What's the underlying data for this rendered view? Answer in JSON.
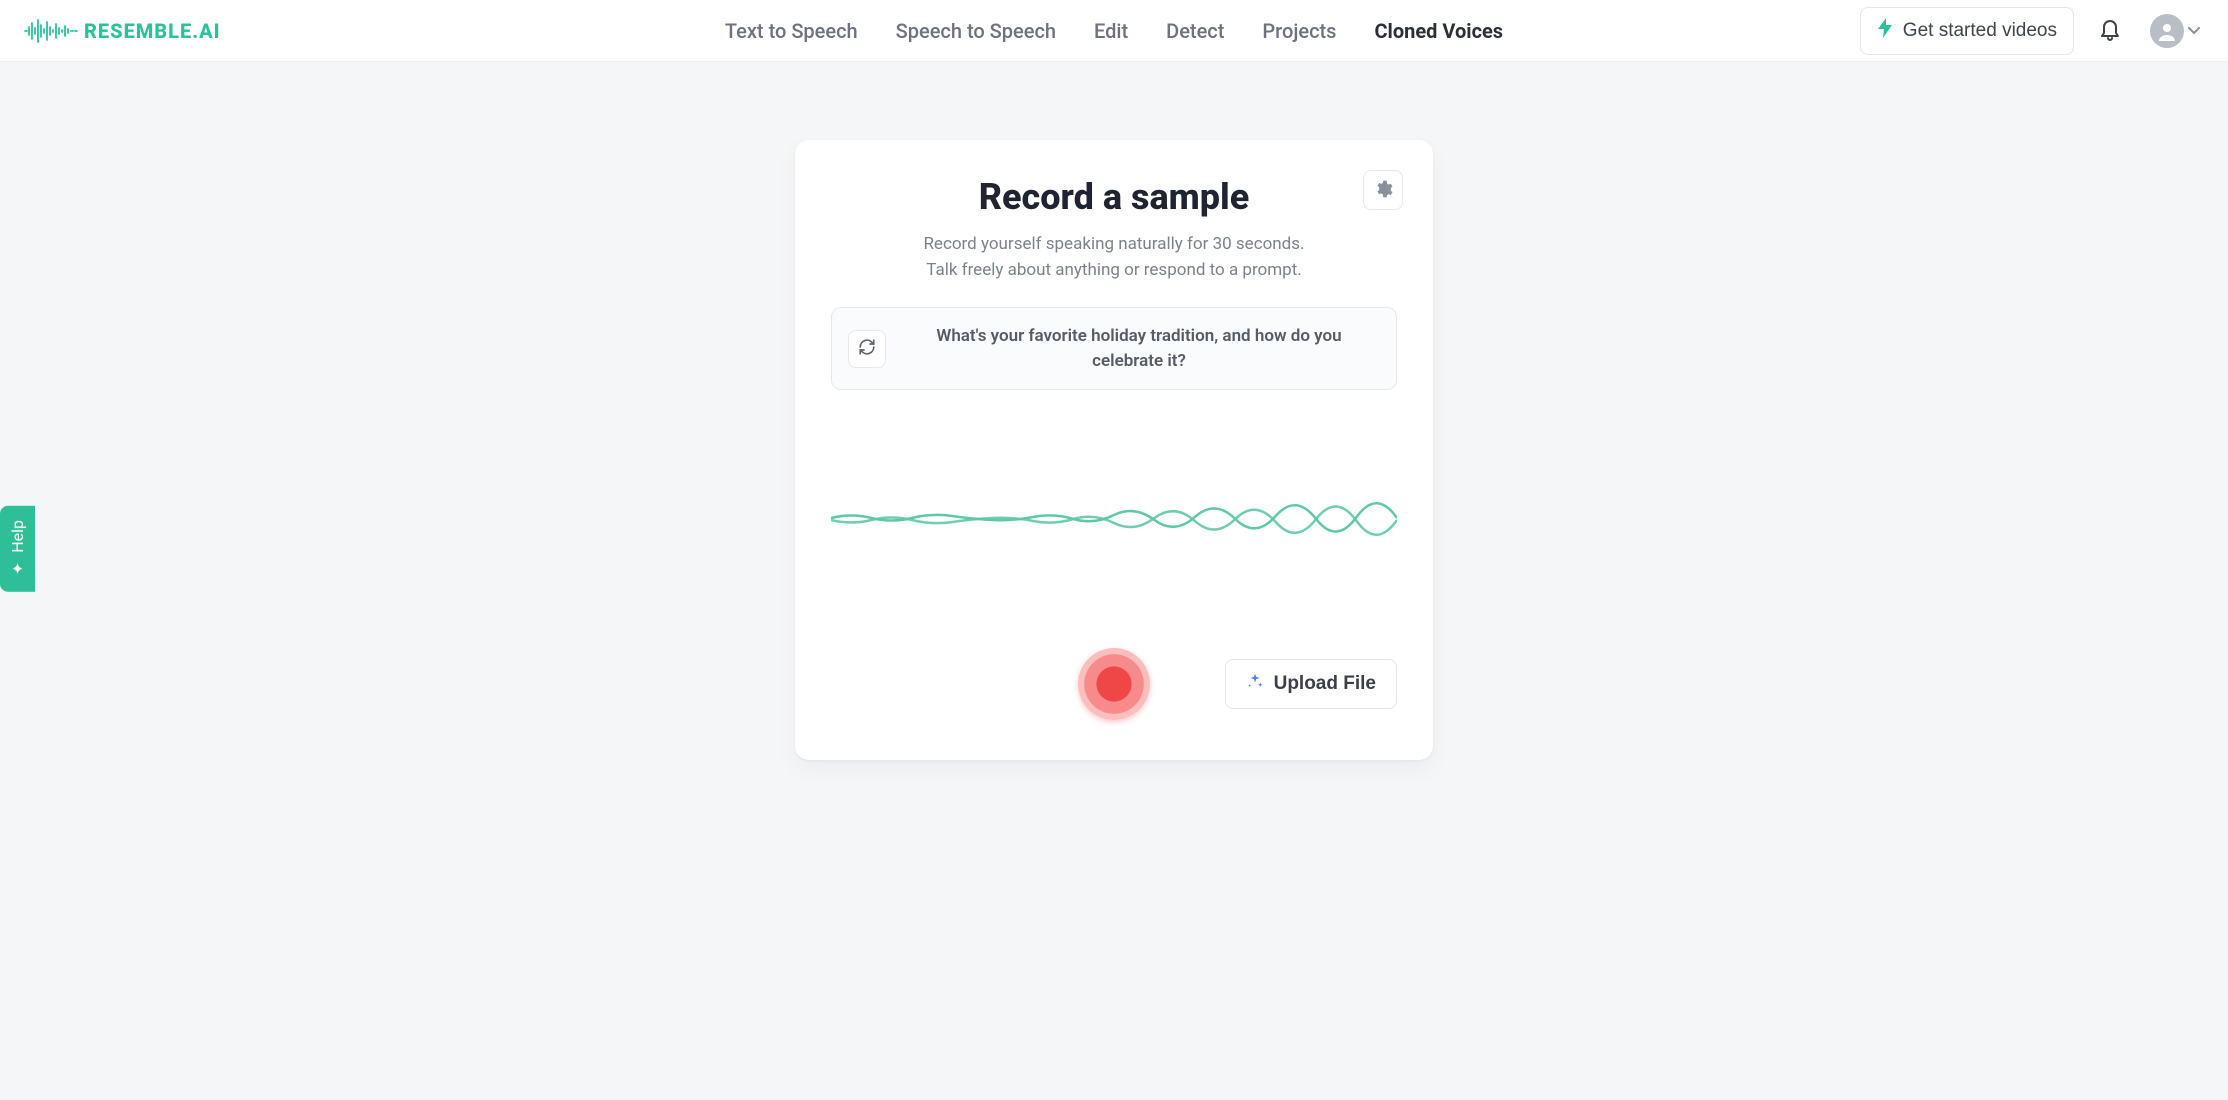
{
  "brand": {
    "name_primary": "RESEMBLE",
    "name_suffix": ".AI"
  },
  "nav": {
    "items": [
      {
        "label": "Text to Speech",
        "active": false
      },
      {
        "label": "Speech to Speech",
        "active": false
      },
      {
        "label": "Edit",
        "active": false
      },
      {
        "label": "Detect",
        "active": false
      },
      {
        "label": "Projects",
        "active": false
      },
      {
        "label": "Cloned Voices",
        "active": true
      }
    ]
  },
  "header_actions": {
    "get_started_label": "Get started videos"
  },
  "help_tab": {
    "label": "Help"
  },
  "card": {
    "title": "Record a sample",
    "subtitle_line1": "Record yourself speaking naturally for 30 seconds.",
    "subtitle_line2": "Talk freely about anything or respond to a prompt.",
    "prompt_text": "What's your favorite holiday tradition, and how do you celebrate it?",
    "upload_label": "Upload File"
  },
  "colors": {
    "accent": "#28c29b",
    "record": "#ef4648",
    "text_muted": "#7b828d"
  }
}
